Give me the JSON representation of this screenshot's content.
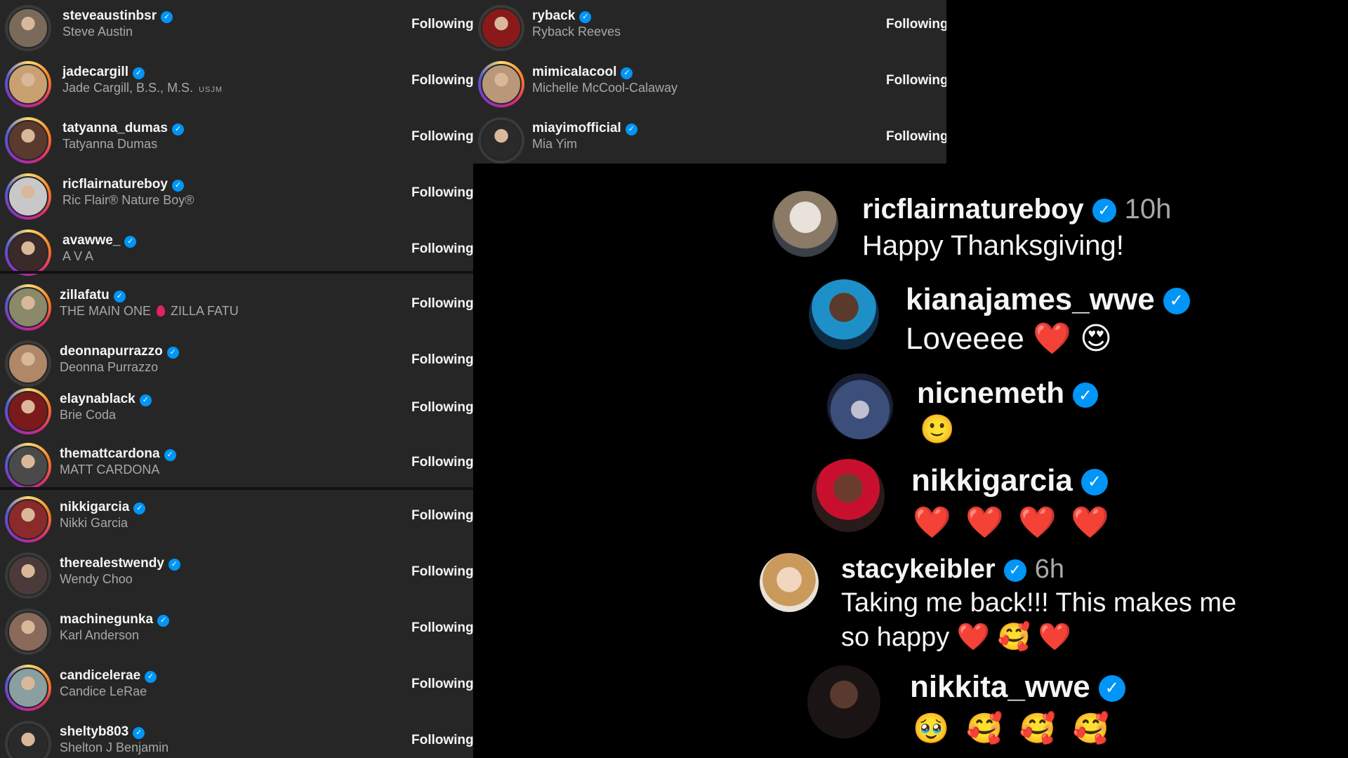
{
  "following_list": {
    "button_label": "Following",
    "left_rows": [
      {
        "username": "steveaustinbsr",
        "full_name": "Steve Austin"
      },
      {
        "username": "jadecargill",
        "full_name": "Jade Cargill, B.S., M.S.",
        "name_suffix": "USJM"
      },
      {
        "username": "tatyanna_dumas",
        "full_name": "Tatyanna Dumas"
      },
      {
        "username": "ricflairnatureboy",
        "full_name": "Ric Flair® Nature Boy®"
      },
      {
        "username": "avawwe_",
        "full_name": "A V A"
      },
      {
        "username": "zillafatu",
        "full_name": "THE MAIN ONE",
        "name_suffix": "ZILLA FATU"
      },
      {
        "username": "deonnapurrazzo",
        "full_name": "Deonna Purrazzo"
      },
      {
        "username": "elaynablack",
        "full_name": "Brie Coda"
      },
      {
        "username": "themattcardona",
        "full_name": "MATT CARDONA"
      },
      {
        "username": "nikkigarcia",
        "full_name": "Nikki Garcia"
      },
      {
        "username": "therealestwendy",
        "full_name": "Wendy Choo"
      },
      {
        "username": "machinegunka",
        "full_name": "Karl Anderson"
      },
      {
        "username": "candicelerae",
        "full_name": "Candice LeRae"
      },
      {
        "username": "sheltyb803",
        "full_name": "Shelton J Benjamin"
      }
    ],
    "right_rows": [
      {
        "username": "ryback",
        "full_name": "Ryback Reeves"
      },
      {
        "username": "mimicalacool",
        "full_name": "Michelle McCool-Calaway"
      },
      {
        "username": "miayimofficial",
        "full_name": "Mia Yim"
      }
    ]
  },
  "comments": [
    {
      "username": "ricflairnatureboy",
      "time": "10h",
      "text": "Happy Thanksgiving!"
    },
    {
      "username": "kianajames_wwe",
      "text": "Loveeee",
      "emoji": "❤️ 😍"
    },
    {
      "username": "nicnemeth",
      "emoji": "🙂"
    },
    {
      "username": "nikkigarcia",
      "emoji": "❤️ ❤️ ❤️ ❤️"
    },
    {
      "username": "stacykeibler",
      "time": "6h",
      "text": "Taking me back!!! This makes me",
      "text2": "so happy",
      "emoji": "❤️ 🥰 ❤️"
    },
    {
      "username": "nikkita_wwe",
      "emoji": "🥹 🥰 🥰 🥰"
    }
  ],
  "colors": {
    "panel": "#262626",
    "background": "#000000",
    "verified": "#0095f6",
    "secondary_text": "#a8a8a8"
  }
}
